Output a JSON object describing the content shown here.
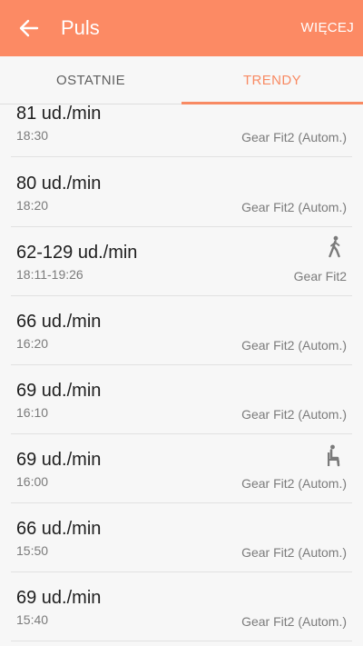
{
  "appbar": {
    "title": "Puls",
    "more_label": "WIĘCEJ",
    "background": "#fc8a64"
  },
  "tabs": {
    "items": [
      {
        "label": "OSTATNIE",
        "active": false
      },
      {
        "label": "TRENDY",
        "active": true
      }
    ],
    "accent": "#f88a63"
  },
  "entries": [
    {
      "value": "81 ud./min",
      "time": "18:30",
      "source": "Gear Fit2 (Autom.)",
      "icon": ""
    },
    {
      "value": "80 ud./min",
      "time": "18:20",
      "source": "Gear Fit2 (Autom.)",
      "icon": ""
    },
    {
      "value": "62-129 ud./min",
      "time": "18:11-19:26",
      "source": "Gear Fit2",
      "icon": "walking-icon"
    },
    {
      "value": "66 ud./min",
      "time": "16:20",
      "source": "Gear Fit2 (Autom.)",
      "icon": ""
    },
    {
      "value": "69 ud./min",
      "time": "16:10",
      "source": "Gear Fit2 (Autom.)",
      "icon": ""
    },
    {
      "value": "69 ud./min",
      "time": "16:00",
      "source": "Gear Fit2 (Autom.)",
      "icon": "sitting-icon"
    },
    {
      "value": "66 ud./min",
      "time": "15:50",
      "source": "Gear Fit2 (Autom.)",
      "icon": ""
    },
    {
      "value": "69 ud./min",
      "time": "15:40",
      "source": "Gear Fit2 (Autom.)",
      "icon": ""
    }
  ]
}
